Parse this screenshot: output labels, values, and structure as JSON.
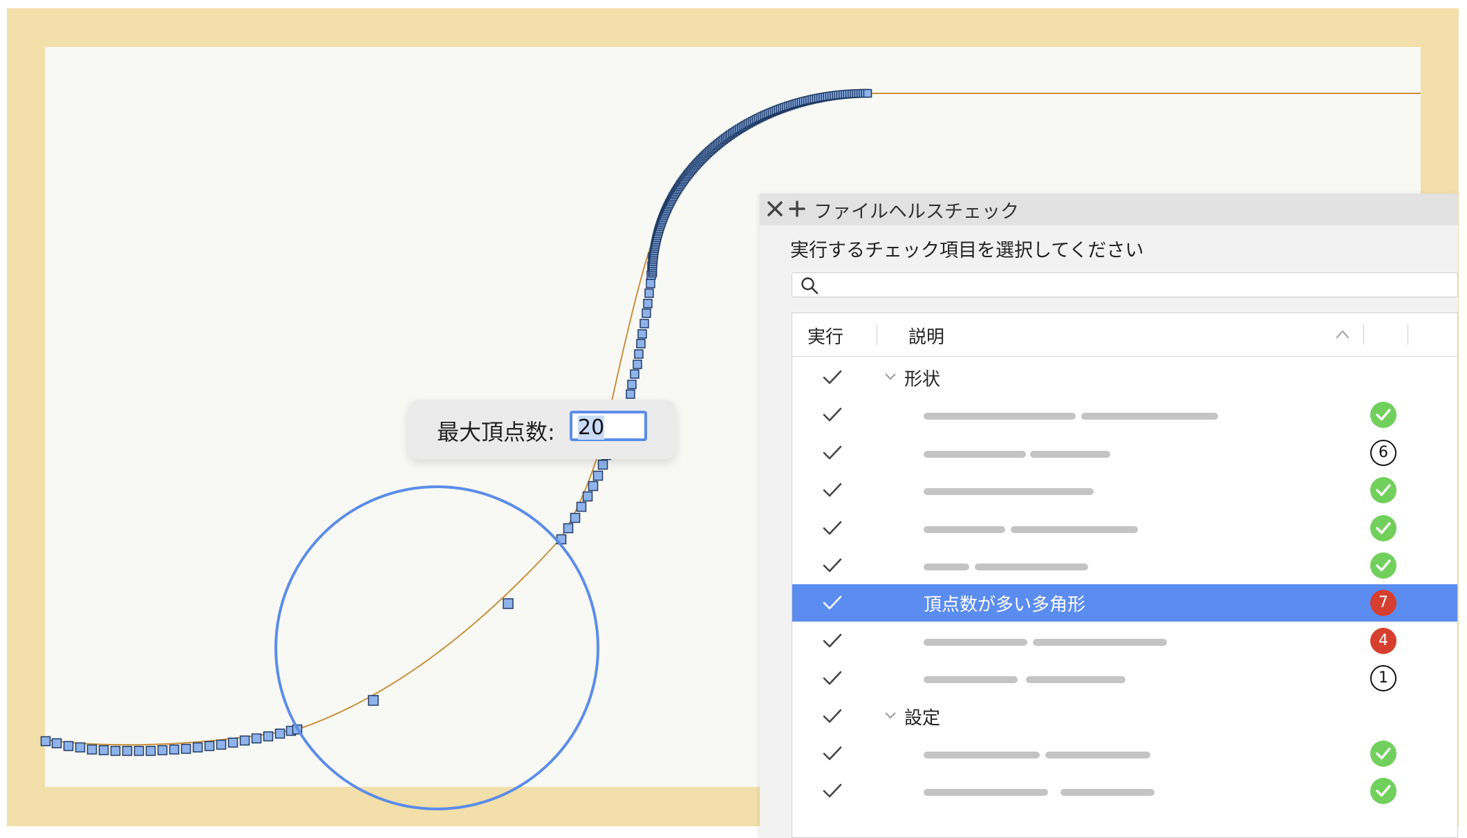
{
  "colors": {
    "frame": "#f3dfaa",
    "canvas": "#f8f8f4",
    "vertex_fill": "#8fb3ea",
    "curve": "#c9913a",
    "highlight_circle": "#5b8de8",
    "selected_row": "#5b8cf0",
    "ok": "#71d05c",
    "error": "#d63f2f"
  },
  "vertex_popup": {
    "label": "最大頂点数:",
    "value": "20"
  },
  "panel": {
    "close_icon": "close-icon",
    "add_icon": "plus-icon",
    "title": "ファイルヘルスチェック",
    "instruction": "実行するチェック項目を選択してください",
    "search": {
      "placeholder": "",
      "value": ""
    },
    "columns": {
      "run": "実行",
      "description": "説明"
    },
    "groups": [
      {
        "label": "形状",
        "items": [
          {
            "label": "",
            "checked": true,
            "status": "ok"
          },
          {
            "label": "",
            "checked": true,
            "status": "count",
            "count": "6"
          },
          {
            "label": "",
            "checked": true,
            "status": "ok"
          },
          {
            "label": "",
            "checked": true,
            "status": "ok"
          },
          {
            "label": "",
            "checked": true,
            "status": "ok"
          },
          {
            "label": "頂点数が多い多角形",
            "checked": true,
            "selected": true,
            "status": "error",
            "count": "7"
          },
          {
            "label": "",
            "checked": true,
            "status": "error",
            "count": "4"
          },
          {
            "label": "",
            "checked": true,
            "status": "count",
            "count": "1"
          }
        ]
      },
      {
        "label": "設定",
        "items": [
          {
            "label": "",
            "checked": true,
            "status": "ok"
          },
          {
            "label": "",
            "checked": true,
            "status": "ok"
          }
        ]
      }
    ]
  }
}
